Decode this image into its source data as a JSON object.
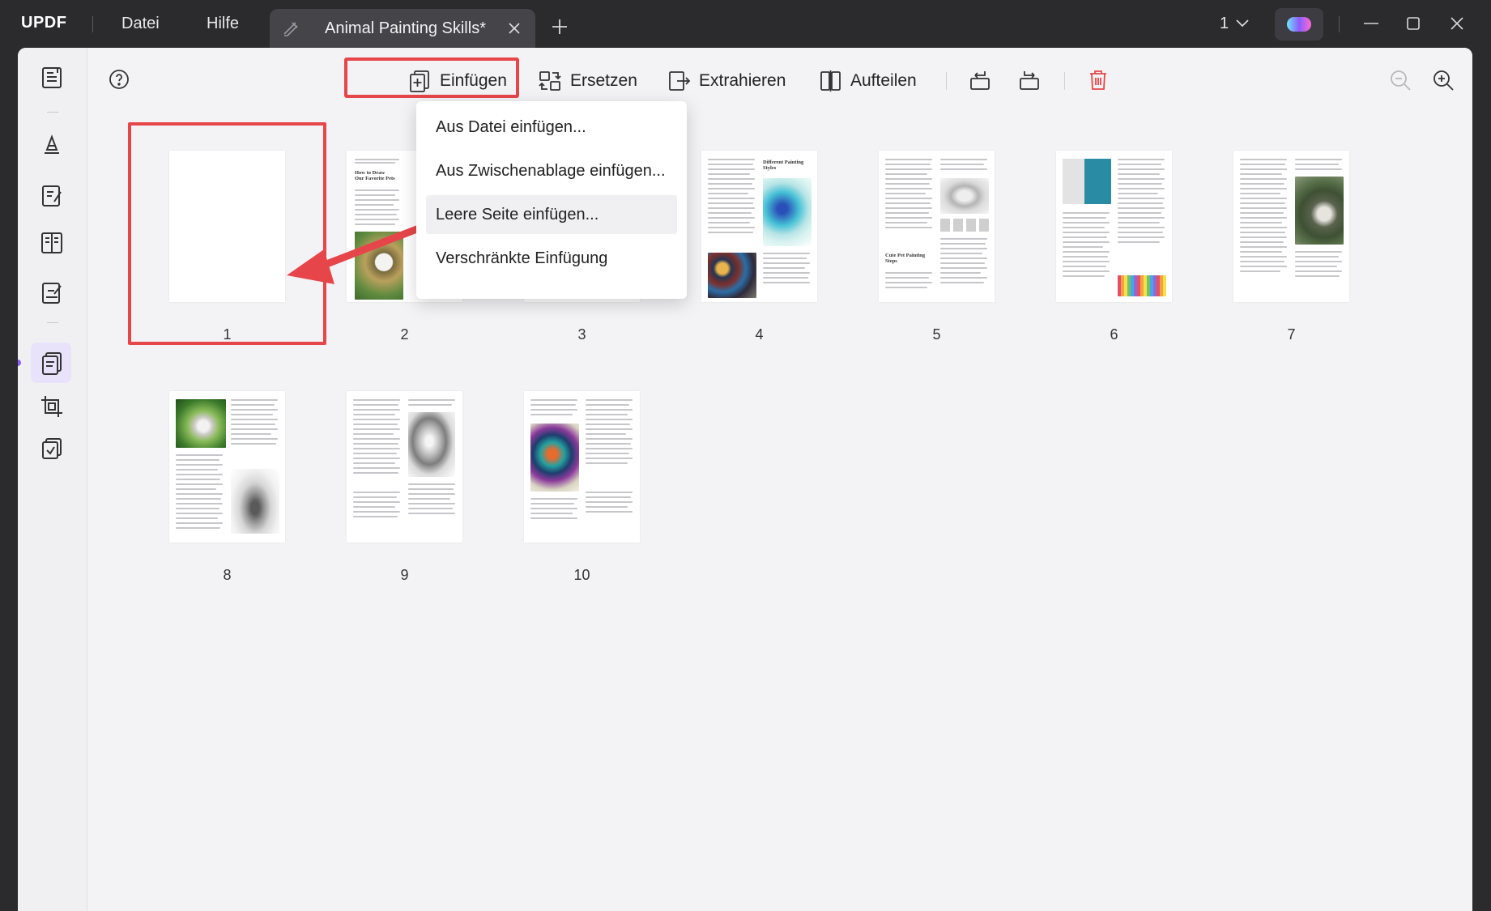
{
  "app": {
    "logo": "UPDF",
    "menu": [
      "Datei",
      "Hilfe"
    ],
    "tab_title": "Animal Painting Skills*",
    "page_indicator": "1"
  },
  "toolbar": {
    "insert_label": "Einfügen",
    "replace_label": "Ersetzen",
    "extract_label": "Extrahieren",
    "split_label": "Aufteilen"
  },
  "insert_menu": {
    "items": [
      "Aus Datei einfügen...",
      "Aus Zwischenablage einfügen...",
      "Leere Seite einfügen...",
      "Verschränkte Einfügung"
    ],
    "hovered_index": 2
  },
  "pages": [
    {
      "number": "1",
      "heading": ""
    },
    {
      "number": "2",
      "heading": "How to Draw Our Favorite Pets"
    },
    {
      "number": "3",
      "heading": ""
    },
    {
      "number": "4",
      "heading": "Different Painting Styles"
    },
    {
      "number": "5",
      "heading": "Cute Pet Painting Steps"
    },
    {
      "number": "6",
      "heading": ""
    },
    {
      "number": "7",
      "heading": ""
    },
    {
      "number": "8",
      "heading": ""
    },
    {
      "number": "9",
      "heading": ""
    },
    {
      "number": "10",
      "heading": ""
    }
  ],
  "colors": {
    "highlight": "#e6464a",
    "accent": "#8a5cff",
    "titlebar": "#2b2b2e",
    "delete": "#e6464a"
  },
  "icons": {
    "sidebar": [
      "reader-icon",
      "comment-icon",
      "edit-icon",
      "form-icon",
      "sign-icon",
      "organize-pages-icon",
      "crop-icon",
      "batch-icon"
    ],
    "toolbar": [
      "help-icon",
      "insert-icon",
      "replace-icon",
      "extract-icon",
      "split-icon",
      "rotate-left-icon",
      "rotate-right-icon",
      "delete-icon",
      "zoom-out-icon",
      "zoom-in-icon"
    ]
  }
}
